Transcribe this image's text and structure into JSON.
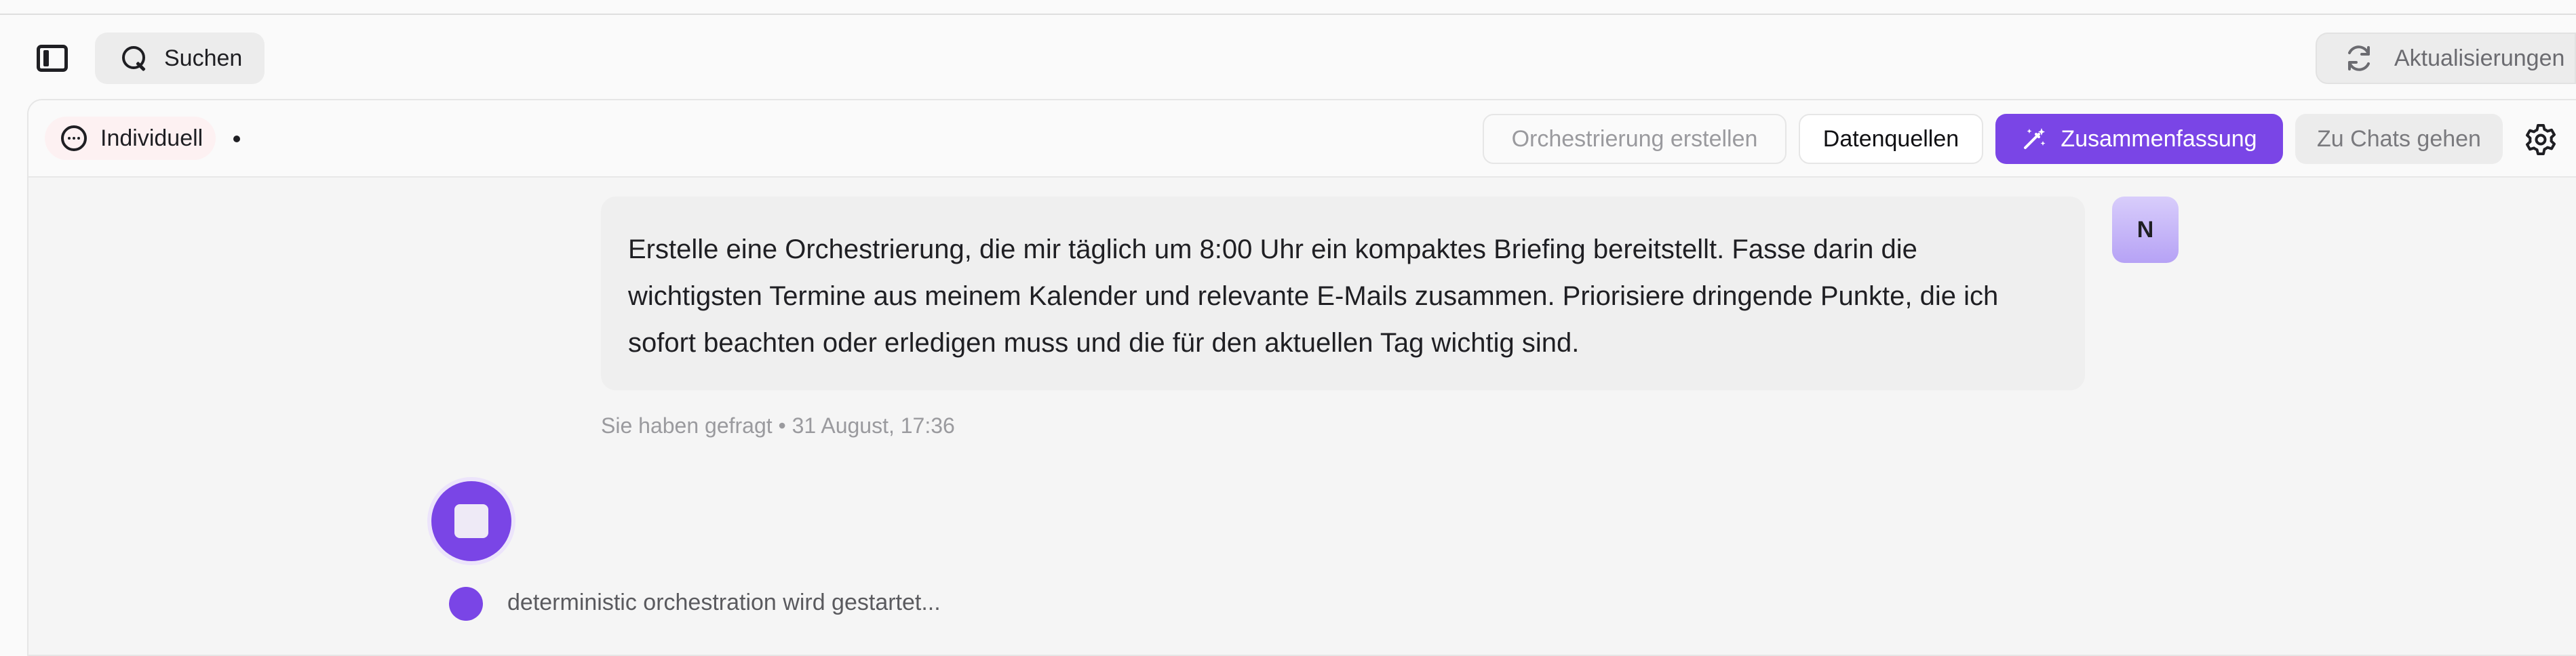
{
  "topbar": {
    "search_label": "Suchen",
    "updates_label": "Aktualisierungen"
  },
  "chat_header": {
    "mode_label": "Individuell",
    "orchestration_button": "Orchestrierung erstellen",
    "datasources_button": "Datenquellen",
    "summary_button": "Zusammenfassung",
    "go_to_chats_button": "Zu Chats gehen"
  },
  "message": {
    "lines": [
      "Erstelle eine Orchestrierung, die mir täglich um 8:00 Uhr ein kompaktes Briefing bereitstellt. Fasse darin die",
      "wichtigsten Termine aus meinem Kalender und relevante E-Mails zusammen. Priorisiere dringende Punkte, die ich",
      "sofort beachten oder erledigen muss und die für den aktuellen Tag wichtig sind."
    ],
    "avatar_initial": "N",
    "meta": "Sie haben gefragt • 31 August, 17:36"
  },
  "progress": {
    "status_text": "deterministic orchestration wird gestartet..."
  },
  "colors": {
    "accent": "#7a45e6",
    "background": "#f5f5f5",
    "bubble": "#efefef"
  },
  "icons": {
    "sidebar_toggle": "sidebar-toggle-icon",
    "search": "search-icon",
    "updates": "refresh-icon",
    "mode": "chat-bubble-icon",
    "summary": "magic-wand-icon",
    "settings": "gear-icon",
    "stop": "stop-icon"
  }
}
